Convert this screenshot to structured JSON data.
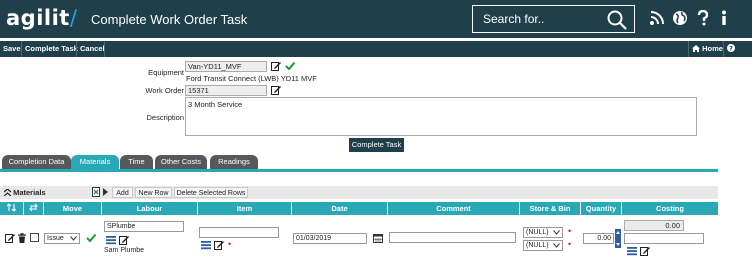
{
  "header": {
    "logo_text": "agilit",
    "logo_slash": "/",
    "title": "Complete Work Order Task",
    "search_placeholder": "Search for.."
  },
  "toolbar": {
    "save": "Save",
    "complete_task": "Complete Task",
    "cancel": "Cancel",
    "home": "Home",
    "help": "Help"
  },
  "form": {
    "equipment_label": "Equipment",
    "equipment_value": "Van-YD11_MVF",
    "equipment_desc": "Ford Transit Connect (LWB) YD11 MVF",
    "work_order_label": "Work Order",
    "work_order_value": "15371",
    "description_label": "Description",
    "description_value": "3 Month Service",
    "complete_button": "Complete Task"
  },
  "tabs": [
    {
      "label": "Completion Data"
    },
    {
      "label": "Materials"
    },
    {
      "label": "Time"
    },
    {
      "label": "Other Costs"
    },
    {
      "label": "Readings"
    }
  ],
  "grid": {
    "title": "Materials",
    "add": "Add",
    "new_row": "New Row",
    "delete_selected": "Delete Selected Rows",
    "columns": [
      "Move",
      "Labour",
      "Item",
      "Date",
      "Comment",
      "Store & Bin",
      "Quantity",
      "Costing"
    ],
    "row": {
      "move": "Issue",
      "labour_code": "SPlumbe",
      "labour_name": "Sam Plumbe",
      "item": "",
      "date": "01/03/2019",
      "comment": "",
      "store": "(NULL)",
      "bin": "(NULL)",
      "quantity": "0.00",
      "costing": "0.00"
    }
  },
  "colors": {
    "header_bg": "#1f3f4a",
    "accent": "#2aa8b5",
    "tab_inactive": "#56585c",
    "required": "#d21f1f",
    "check": "#1e9e2e"
  }
}
